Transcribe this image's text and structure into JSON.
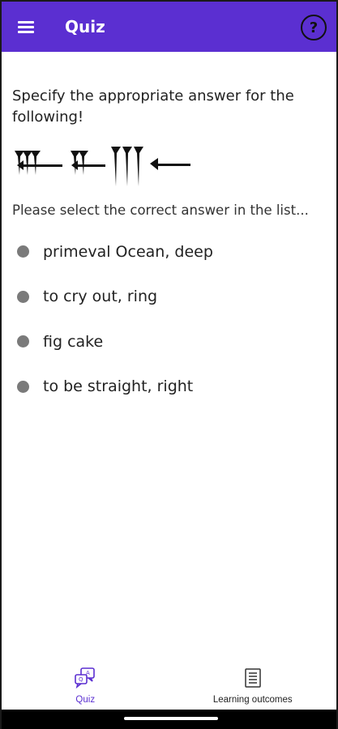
{
  "app_bar": {
    "title": "Quiz",
    "menu_icon": "hamburger-menu-icon",
    "help_icon": "help-circle-icon",
    "help_glyph": "?",
    "accent_color": "#5b2fd1"
  },
  "question": {
    "prompt": "Specify the appropriate answer for the following!",
    "cuneiform_image": "cuneiform-sign-sequence",
    "instruction": "Please select the correct answer in the list..."
  },
  "answers": [
    {
      "label": "primeval Ocean, deep"
    },
    {
      "label": "to cry out, ring"
    },
    {
      "label": "fig cake"
    },
    {
      "label": "to be straight, right"
    }
  ],
  "bottom_nav": {
    "items": [
      {
        "label": "Quiz",
        "icon": "quiz-chat-icon",
        "active": true
      },
      {
        "label": "Learning outcomes",
        "icon": "document-list-icon",
        "active": false
      }
    ]
  }
}
